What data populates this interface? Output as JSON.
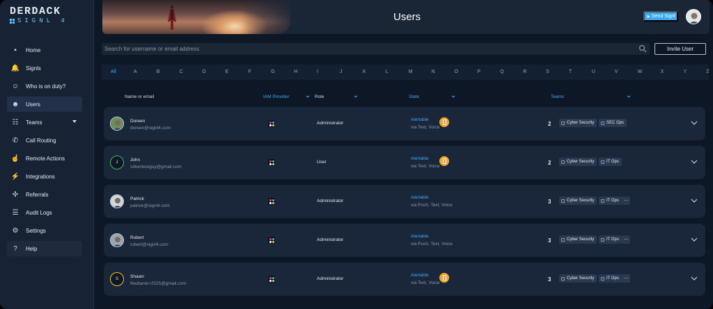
{
  "brand": {
    "top": "DERDACK",
    "bottom": "SIGNL 4"
  },
  "nav": [
    {
      "label": "Home",
      "icon": "home-icon",
      "glyph": "▪"
    },
    {
      "label": "Signls",
      "icon": "bell-icon",
      "glyph": "🔔"
    },
    {
      "label": "Who is on duty?",
      "icon": "user-clock-icon",
      "glyph": "☺"
    },
    {
      "label": "Users",
      "icon": "user-icon",
      "glyph": "☻",
      "active": true
    },
    {
      "label": "Teams",
      "icon": "teams-icon",
      "glyph": "☷",
      "caret": true
    },
    {
      "label": "Call Routing",
      "icon": "phone-icon",
      "glyph": "✆"
    },
    {
      "label": "Remote Actions",
      "icon": "hand-icon",
      "glyph": "☝"
    },
    {
      "label": "Integrations",
      "icon": "plug-icon",
      "glyph": "⚡"
    },
    {
      "label": "Referrals",
      "icon": "referrals-icon",
      "glyph": "✣"
    },
    {
      "label": "Audit Logs",
      "icon": "audit-icon",
      "glyph": "☰"
    },
    {
      "label": "Settings",
      "icon": "gear-icon",
      "glyph": "⚙"
    },
    {
      "label": "Help",
      "icon": "help-icon",
      "glyph": "?",
      "help": true
    }
  ],
  "header": {
    "title": "Users",
    "send_label": "Send Signl"
  },
  "search": {
    "placeholder": "Search for username or email address"
  },
  "invite_label": "Invite User",
  "alphabet": [
    "All",
    "A",
    "B",
    "C",
    "D",
    "E",
    "F",
    "G",
    "H",
    "I",
    "J",
    "K",
    "L",
    "M",
    "N",
    "O",
    "P",
    "Q",
    "R",
    "S",
    "T",
    "U",
    "V",
    "W",
    "X",
    "Y",
    "Z"
  ],
  "columns": {
    "name": "Name or email",
    "iam": "IAM Provider",
    "role": "Role",
    "state": "State",
    "teams": "Teams"
  },
  "users": [
    {
      "name": "Doreen",
      "email": "doreen@signl4.com",
      "role": "Administrator",
      "state": "Alertable",
      "via": "via Text, Voice",
      "phone": true,
      "team_count": "2",
      "teams": [
        "Cyber Security",
        "SEC Ops"
      ],
      "more": "",
      "avatar": "photo",
      "avatar_color": "#6a8f5a"
    },
    {
      "name": "John",
      "email": "s4lwotestguy@gmail.com",
      "role": "User",
      "state": "Alertable",
      "via": "via Text, Voice",
      "phone": true,
      "team_count": "2",
      "teams": [
        "Cyber Security",
        "IT Ops"
      ],
      "more": "",
      "avatar": "initial",
      "initial": "J",
      "avatar_color": "#3fbf4a"
    },
    {
      "name": "Patrick",
      "email": "patrick@signl4.com",
      "role": "Administrator",
      "state": "Alertable",
      "via": "via Push, Text, Voice",
      "phone": false,
      "team_count": "3",
      "teams": [
        "Cyber Security",
        "IT Ops"
      ],
      "more": "...",
      "avatar": "photo",
      "avatar_color": "#cfd6de"
    },
    {
      "name": "Robert",
      "email": "robert@signl4.com",
      "role": "Administrator",
      "state": "Alertable",
      "via": "via Push, Text, Voice",
      "phone": false,
      "team_count": "3",
      "teams": [
        "Cyber Security",
        "IT Ops"
      ],
      "more": "...",
      "avatar": "photo",
      "avatar_color": "#9aa6b3"
    },
    {
      "name": "Shawn",
      "email": "filediante+2025@gmail.com",
      "role": "Administrator",
      "state": "Alertable",
      "via": "via Text, Voice",
      "phone": true,
      "team_count": "3",
      "teams": [
        "Cyber Security",
        "IT Ops"
      ],
      "more": "...",
      "avatar": "initial",
      "initial": "S",
      "avatar_color": "#f5c518"
    }
  ]
}
